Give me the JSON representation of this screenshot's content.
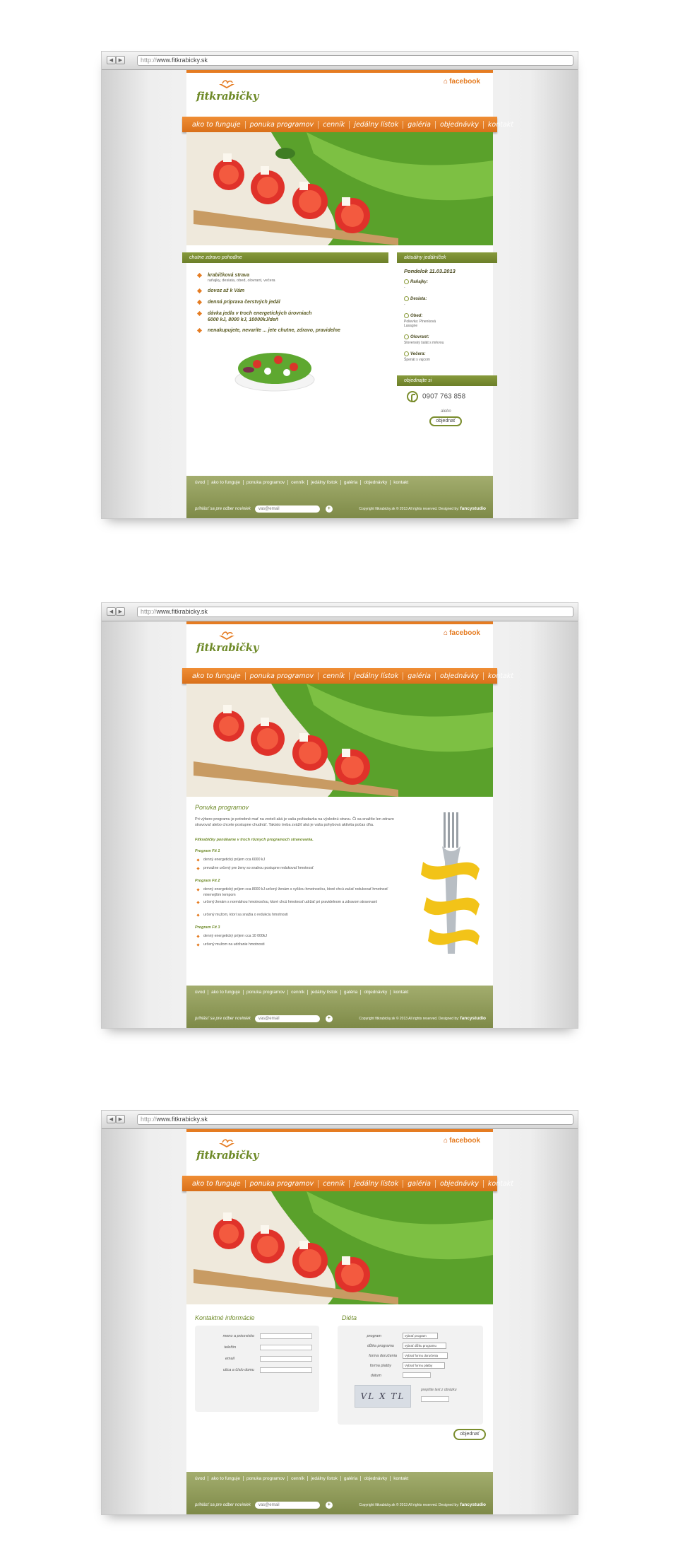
{
  "browser": {
    "url_protocol": "http://",
    "url_host": "www.fitkrabicky.sk",
    "back_glyph": "◀",
    "forward_glyph": "▶"
  },
  "site": {
    "logo_text": "fitkrabičky",
    "facebook_label": "facebook",
    "home_glyph": "⌂",
    "accent": "#e57c22",
    "brand_green": "#6e8a28",
    "menu": [
      "ako to funguje",
      "ponuka programov",
      "cenník",
      "jedálny lístok",
      "galéria",
      "objednávky",
      "kontakt"
    ],
    "footer_links": [
      "úvod",
      "ako to funguje",
      "ponuka programov",
      "cenník",
      "jedálny lístok",
      "galéria",
      "objednávky",
      "kontakt"
    ],
    "newsletter_label": "prihlásť sa pre odber noviniek",
    "newsletter_placeholder": "vas@email",
    "newsletter_button": "+",
    "copyright": "Copyright fitkrabicky.sk © 2013 All rights reserved. Designed by:",
    "designer": "fancystudio"
  },
  "page1": {
    "section_title": "chutne zdravo pohodlne",
    "bullets": [
      {
        "title": "krabičková strava",
        "sub": "raňajky, desiata, obed, olovrant, večera"
      },
      {
        "title": "dovoz až k Vám",
        "sub": ""
      },
      {
        "title": "denná príprava čerstvých jedál",
        "sub": ""
      },
      {
        "title": "dávka jedla v troch energetických úrovniach",
        "sub2": "6000 kJ, 8000 kJ, 10000kJ/deň"
      },
      {
        "title": "nenakupujete, nevaríte ... jete chutne, zdravo, pravidelne",
        "sub": ""
      }
    ],
    "menu_title": "aktuálny jedálníček",
    "menu_date": "Pondelok 11.03.2013",
    "meals": [
      {
        "label": "Raňajky:",
        "value": "-"
      },
      {
        "label": "Desiata:",
        "value": "-"
      },
      {
        "label": "Obed:",
        "value": "Polievka: Plnenková",
        "value2": "Lasagne"
      },
      {
        "label": "Olovrant:",
        "value": "Slovenský šalát s mrkvou"
      },
      {
        "label": "Večera:",
        "value": "Špenát s vajcom"
      }
    ],
    "order_title": "objednajte si",
    "phone": "0907 763 858",
    "or_text": "alebo",
    "order_button": "objednať"
  },
  "page2": {
    "title": "Ponuka programov",
    "intro": "Pri výbere programu je potrebné mať na zreteli aká je vaša požiadavka na výslednú stravu. Či sa snažíte len zdravo stravovať alebo chcete postupne chudnúť. Takisto treba zvážiť aká je vaša pohybová aktivita počas dňa.",
    "lead": "Fitkrabičky ponúkame v troch rôznych programoch stravovania.",
    "programs": [
      {
        "name": "Program Fit 1",
        "items": [
          "denný energetický príjem cca 6000 kJ",
          "prevažne určený pre ženy so snahou postupne redukovať hmotnosť"
        ]
      },
      {
        "name": "Program Fit 2",
        "items": [
          "denný energetický príjem cca 8000 kJ-určený ženám s vyššou hmotnosťou, ktoré chcú začať redukovať hmotnosť miernejším tempom",
          "určený ženám s normálnou hmotnosťou, ktoré chcú hmotnosť udržať pri pravidelnom a zdravom stravovaní",
          "určený mužom, ktorí sa snažia o redukciu hmotnosti"
        ]
      },
      {
        "name": "Program Fit 3",
        "items": [
          "denný energetický príjem cca 10 000kJ",
          "určený mužom na udržanie hmotnosti"
        ]
      }
    ]
  },
  "page3": {
    "contact_title": "Kontaktné informácie",
    "contact_fields": [
      "meno a priezvisko",
      "telefón",
      "email",
      "ulica a číslo domu"
    ],
    "diet_title": "Diéta",
    "diet_fields": [
      {
        "label": "program",
        "value": "vybrať program"
      },
      {
        "label": "dĺžka programu",
        "value": "vybrať dĺžku programu"
      },
      {
        "label": "forma doručenia",
        "value": "Vybrať formu doručenia"
      },
      {
        "label": "forma platby",
        "value": "Vybrať formu platby"
      },
      {
        "label": "dátum",
        "value": ""
      }
    ],
    "captcha_text": "VL X TL",
    "captcha_hint": "prepíšte text z obrázku",
    "submit": "objednať"
  }
}
